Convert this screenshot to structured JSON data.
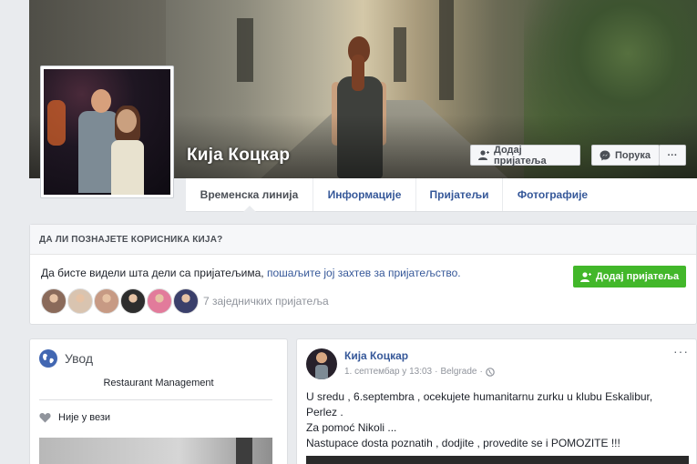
{
  "profile": {
    "name": "Кија Коцкар"
  },
  "cover_actions": {
    "add_friend": "Додај пријатеља",
    "message": "Порука",
    "more": "···"
  },
  "tabs": [
    {
      "label": "Временска линија",
      "active": true
    },
    {
      "label": "Информације",
      "active": false
    },
    {
      "label": "Пријатељи",
      "active": false
    },
    {
      "label": "Фотографије",
      "active": false
    }
  ],
  "know_box": {
    "header": "ДА ЛИ ПОЗНАЈЕТЕ КОРИСНИКА КИЈА?",
    "text": "Да бисте видели шта дели са пријатељима, ",
    "link": "пошаљите јој захтев за пријатељство.",
    "add_button": "Додај пријатеља",
    "mutual_friends": "7 заједничких пријатеља",
    "friend_colors": [
      "#8a6a5a",
      "#d9c4b0",
      "#c79a84",
      "#2d2d2d",
      "#e27b9b",
      "#3a3f6a"
    ]
  },
  "intro": {
    "title": "Увод",
    "job": "Restaurant Management",
    "relationship": "Није у вези"
  },
  "post": {
    "author": "Кија Коцкар",
    "date": "1. септембар у 13:03",
    "separator": "·",
    "location": "Belgrade",
    "more": "···",
    "lines": [
      "U sredu , 6.septembra , ocekujete humanitarnu zurku u klubu Eskalibur,",
      "Perlez .",
      "Za pomoć Nikoli ...",
      "Nastupace dosta poznatih , dodjite , provedite se i POMOZITE !!!"
    ]
  },
  "colors": {
    "link_blue": "#365899",
    "green": "#42b72a",
    "page_bg": "#e9ebee"
  }
}
